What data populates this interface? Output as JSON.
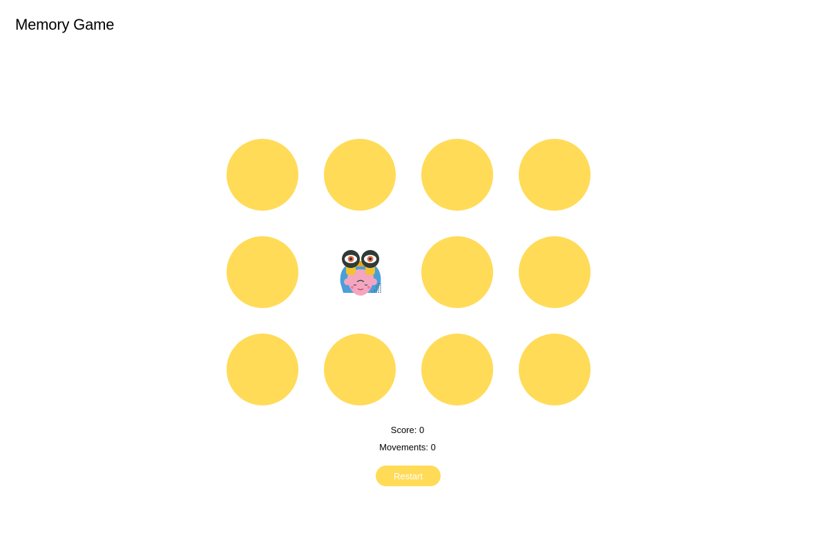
{
  "header": {
    "title": "Memory Game"
  },
  "colors": {
    "card_back": "#ffdb58",
    "button_bg": "#ffdb58",
    "button_text": "#ffffff"
  },
  "board": {
    "cards": [
      {
        "state": "hidden"
      },
      {
        "state": "hidden"
      },
      {
        "state": "hidden"
      },
      {
        "state": "hidden"
      },
      {
        "state": "hidden"
      },
      {
        "state": "revealed",
        "icon": "binoculars-person-icon"
      },
      {
        "state": "hidden"
      },
      {
        "state": "hidden"
      },
      {
        "state": "hidden"
      },
      {
        "state": "hidden"
      },
      {
        "state": "hidden"
      },
      {
        "state": "hidden"
      }
    ]
  },
  "stats": {
    "score_text": "Score: 0",
    "movements_text": "Movements: 0"
  },
  "controls": {
    "restart_label": "Restart"
  }
}
